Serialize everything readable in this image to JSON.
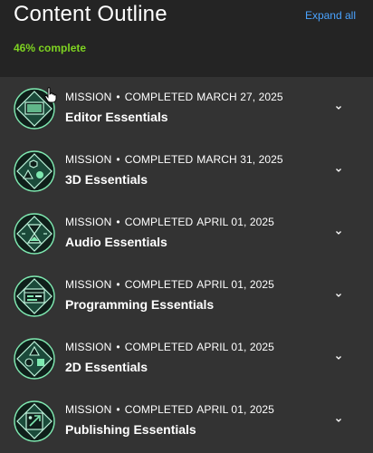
{
  "header": {
    "title": "Content Outline",
    "expand_label": "Expand all",
    "progress_text": "46% complete"
  },
  "colors": {
    "page_bg": "#242424",
    "list_bg": "#333333",
    "accent_link": "#4aa3ff",
    "progress_green": "#7ed321",
    "badge_green": "#7ee8b0"
  },
  "items": [
    {
      "type": "MISSION",
      "status": "COMPLETED",
      "date": "MARCH 27, 2025",
      "name": "Editor Essentials",
      "icon": "editor-window-icon"
    },
    {
      "type": "MISSION",
      "status": "COMPLETED",
      "date": "MARCH 31, 2025",
      "name": "3D Essentials",
      "icon": "3d-shapes-icon"
    },
    {
      "type": "MISSION",
      "status": "COMPLETED",
      "date": "APRIL 01, 2025",
      "name": "Audio Essentials",
      "icon": "hourglass-audio-icon"
    },
    {
      "type": "MISSION",
      "status": "COMPLETED",
      "date": "APRIL 01, 2025",
      "name": "Programming Essentials",
      "icon": "code-window-icon"
    },
    {
      "type": "MISSION",
      "status": "COMPLETED",
      "date": "APRIL 01, 2025",
      "name": "2D Essentials",
      "icon": "2d-shapes-icon"
    },
    {
      "type": "MISSION",
      "status": "COMPLETED",
      "date": "APRIL 01, 2025",
      "name": "Publishing Essentials",
      "icon": "publish-export-icon"
    }
  ]
}
